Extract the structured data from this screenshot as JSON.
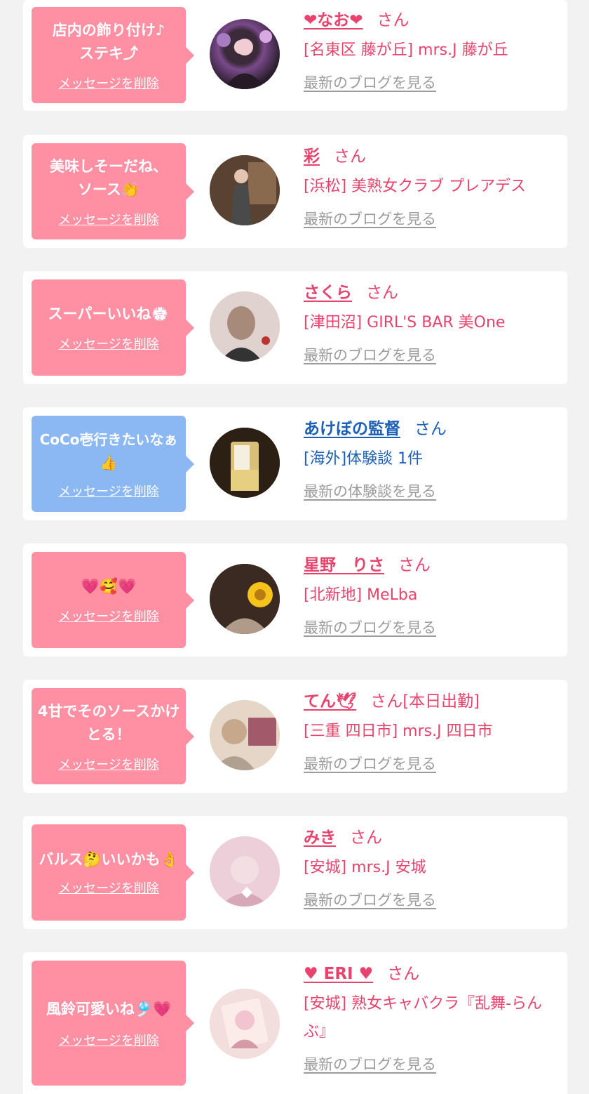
{
  "colors": {
    "pink_bubble": "#ff8fa3",
    "blue_bubble": "#8bb8f3",
    "pink_text": "#e8436d",
    "blue_text": "#1c5fb8",
    "link_gray": "#9b9b9b"
  },
  "delete_label": "メッセージを削除",
  "san_label": "さん",
  "items": [
    {
      "bubble_text": "店内の飾り付け♪ステキ⤴",
      "name": "❤なお❤",
      "san": "さん",
      "shop": "[名東区 藤が丘] mrs.J 藤が丘",
      "more": "最新のブログを見る"
    },
    {
      "bubble_text": "美味しそーだね、ソース👏",
      "name": "彩",
      "san": "さん",
      "shop": "[浜松] 美熟女クラブ プレアデス",
      "more": "最新のブログを見る"
    },
    {
      "bubble_text": "スーパーいいね💮",
      "name": "さくら",
      "san": "さん",
      "shop": "[津田沼] GIRL'S BAR 美One",
      "more": "最新のブログを見る"
    },
    {
      "bubble_text": "CoCo壱行きたいなぁ👍",
      "name": "あけぼの監督",
      "san": "さん",
      "shop": "[海外]体験談 1件",
      "more": "最新の体験談を見る"
    },
    {
      "bubble_text": "💗🥰💗",
      "name": "星野　りさ",
      "san": "さん",
      "shop": "[北新地] MeLba",
      "more": "最新のブログを見る"
    },
    {
      "bubble_text": "4甘でそのソースかけとる！",
      "name": "てん🕊",
      "san": "さん[本日出勤]",
      "shop": "[三重 四日市] mrs.J 四日市",
      "more": "最新のブログを見る"
    },
    {
      "bubble_text": "バルス🤔いいかも👌",
      "name": "みき",
      "san": "さん",
      "shop": "[安城] mrs.J 安城",
      "more": "最新のブログを見る"
    },
    {
      "bubble_text": "風鈴可愛いね🎐💗",
      "name": "♥ ERI ♥",
      "san": "さん",
      "shop": "[安城] 熟女キャバクラ『乱舞-らんぶ』",
      "more": "最新のブログを見る"
    }
  ]
}
